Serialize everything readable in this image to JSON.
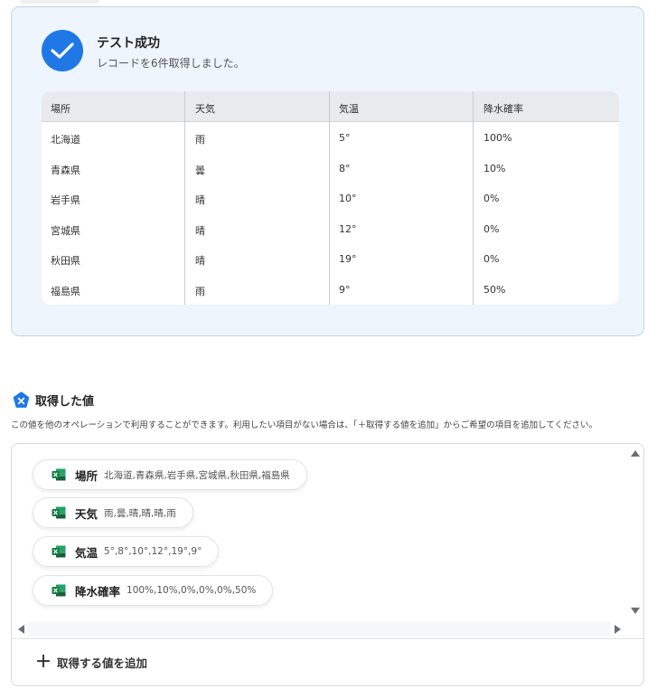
{
  "result": {
    "title": "テスト成功",
    "subtitle": "レコードを6件取得しました。",
    "columns": [
      "場所",
      "天気",
      "気温",
      "降水確率"
    ],
    "rows": [
      [
        "北海道",
        "雨",
        "5°",
        "100%"
      ],
      [
        "青森県",
        "曇",
        "8°",
        "10%"
      ],
      [
        "岩手県",
        "晴",
        "10°",
        "0%"
      ],
      [
        "宮城県",
        "晴",
        "12°",
        "0%"
      ],
      [
        "秋田県",
        "晴",
        "19°",
        "0%"
      ],
      [
        "福島県",
        "雨",
        "9°",
        "50%"
      ]
    ]
  },
  "acquired": {
    "title": "取得した値",
    "description": "この値を他のオペレーションで利用することができます。利用したい項目がない場合は、「＋取得する値を追加」からご希望の項目を追加してください。",
    "items": [
      {
        "label": "場所",
        "value": "北海道,青森県,岩手県,宮城県,秋田県,福島県"
      },
      {
        "label": "天気",
        "value": "雨,曇,晴,晴,晴,雨"
      },
      {
        "label": "気温",
        "value": "5°,8°,10°,12°,19°,9°"
      },
      {
        "label": "降水確率",
        "value": "100%,10%,0%,0%,0%,50%"
      }
    ],
    "add_label": "取得する値を追加"
  },
  "colors": {
    "accent": "#1f78e6",
    "card_bg": "#eef5fd",
    "excel_green": "#1e7145"
  },
  "icons": [
    "check-icon",
    "variable-badge-icon",
    "excel-icon",
    "plus-icon",
    "scroll-arrow-icons"
  ]
}
